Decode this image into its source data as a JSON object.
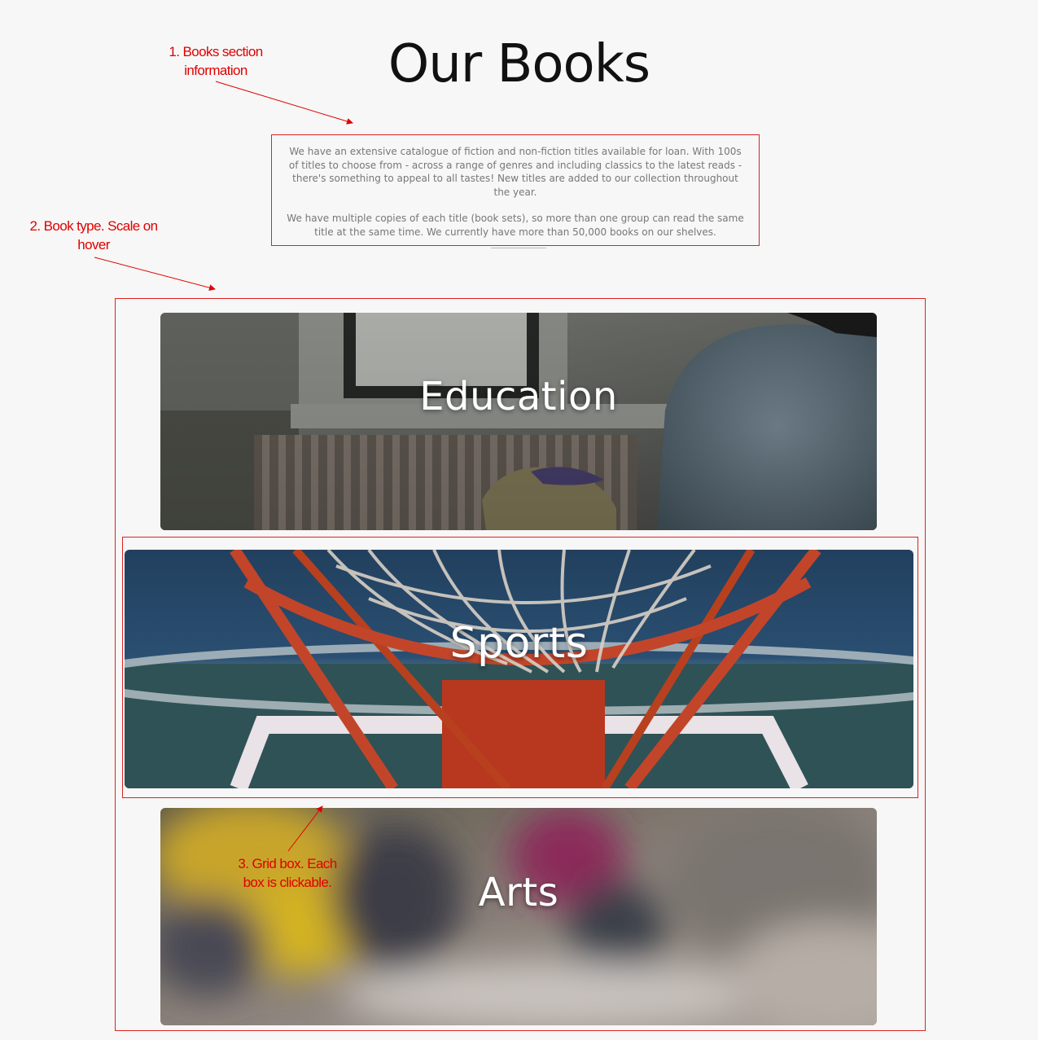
{
  "page": {
    "title": "Our Books"
  },
  "intro": {
    "paragraph1": "We have an extensive catalogue of fiction and non-fiction titles available for loan. With 100s of titles to choose from - across a range of genres and including classics to the latest reads - there's something to appeal to all tastes! New titles are added to our collection throughout the year.",
    "paragraph2": "We have multiple copies of each title (book sets), so more than one group can read the same title at the same time. We currently have more than 50,000 books on our shelves."
  },
  "annotations": {
    "a1": "1. Books section information",
    "a2": "2. Book type.  Scale on hover",
    "a3": "3. Grid box. Each box is clickable.",
    "color": "#e00000"
  },
  "categories": [
    {
      "label": "Education",
      "image": "student-by-radiator-photo"
    },
    {
      "label": "Sports",
      "image": "basketball-hoop-photo"
    },
    {
      "label": "Arts",
      "image": "blurred-art-supplies-photo"
    }
  ],
  "colors": {
    "background": "#f7f7f7",
    "title_text": "#111111",
    "body_text": "#777777",
    "annotation_border": "#dd2222",
    "card_label": "#ffffff"
  }
}
